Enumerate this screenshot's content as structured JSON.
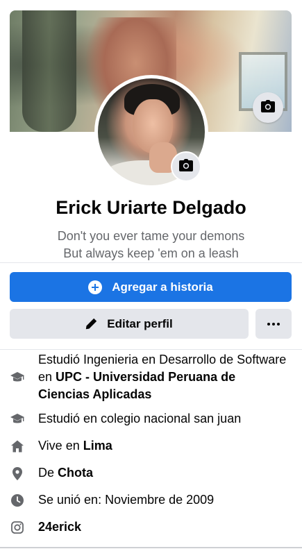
{
  "profile": {
    "name": "Erick Uriarte Delgado",
    "bio_line1": "Don't you ever tame your demons",
    "bio_line2": "But always keep 'em on a leash"
  },
  "actions": {
    "add_story_label": "Agregar a historia",
    "edit_profile_label": "Editar perfil"
  },
  "details": {
    "education1": {
      "prefix": "Estudió Ingenieria en Desarrollo de Software en ",
      "place": "UPC - Universidad Peruana de Ciencias Aplicadas"
    },
    "education2": {
      "text": "Estudió en colegio nacional san juan"
    },
    "lives": {
      "prefix": "Vive en ",
      "place": "Lima"
    },
    "from": {
      "prefix": "De ",
      "place": "Chota"
    },
    "joined": {
      "text": "Se unió en: Noviembre de 2009"
    },
    "instagram": {
      "handle": "24erick"
    }
  },
  "colors": {
    "primary": "#1b74e4",
    "secondary_button": "#e4e6eb",
    "muted_text": "#65676b"
  },
  "icons": {
    "cover_camera": "camera-icon",
    "avatar_camera": "camera-icon",
    "add_story": "plus-circle-icon",
    "edit": "pencil-icon",
    "more": "more-dots-icon",
    "education": "graduation-cap-icon",
    "home": "home-icon",
    "location": "location-pin-icon",
    "clock": "clock-icon",
    "instagram": "instagram-icon"
  }
}
